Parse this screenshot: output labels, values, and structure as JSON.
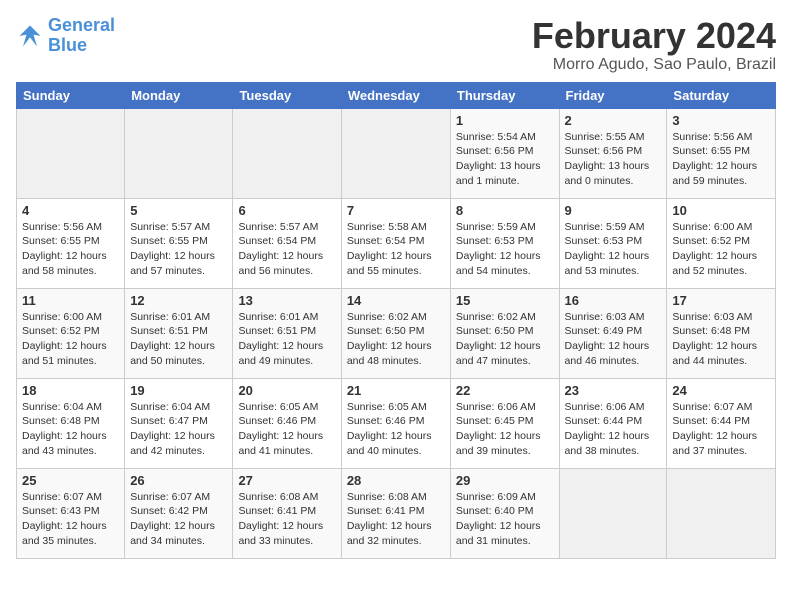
{
  "header": {
    "logo_line1": "General",
    "logo_line2": "Blue",
    "month": "February 2024",
    "location": "Morro Agudo, Sao Paulo, Brazil"
  },
  "weekdays": [
    "Sunday",
    "Monday",
    "Tuesday",
    "Wednesday",
    "Thursday",
    "Friday",
    "Saturday"
  ],
  "weeks": [
    [
      {
        "day": "",
        "info": ""
      },
      {
        "day": "",
        "info": ""
      },
      {
        "day": "",
        "info": ""
      },
      {
        "day": "",
        "info": ""
      },
      {
        "day": "1",
        "info": "Sunrise: 5:54 AM\nSunset: 6:56 PM\nDaylight: 13 hours\nand 1 minute."
      },
      {
        "day": "2",
        "info": "Sunrise: 5:55 AM\nSunset: 6:56 PM\nDaylight: 13 hours\nand 0 minutes."
      },
      {
        "day": "3",
        "info": "Sunrise: 5:56 AM\nSunset: 6:55 PM\nDaylight: 12 hours\nand 59 minutes."
      }
    ],
    [
      {
        "day": "4",
        "info": "Sunrise: 5:56 AM\nSunset: 6:55 PM\nDaylight: 12 hours\nand 58 minutes."
      },
      {
        "day": "5",
        "info": "Sunrise: 5:57 AM\nSunset: 6:55 PM\nDaylight: 12 hours\nand 57 minutes."
      },
      {
        "day": "6",
        "info": "Sunrise: 5:57 AM\nSunset: 6:54 PM\nDaylight: 12 hours\nand 56 minutes."
      },
      {
        "day": "7",
        "info": "Sunrise: 5:58 AM\nSunset: 6:54 PM\nDaylight: 12 hours\nand 55 minutes."
      },
      {
        "day": "8",
        "info": "Sunrise: 5:59 AM\nSunset: 6:53 PM\nDaylight: 12 hours\nand 54 minutes."
      },
      {
        "day": "9",
        "info": "Sunrise: 5:59 AM\nSunset: 6:53 PM\nDaylight: 12 hours\nand 53 minutes."
      },
      {
        "day": "10",
        "info": "Sunrise: 6:00 AM\nSunset: 6:52 PM\nDaylight: 12 hours\nand 52 minutes."
      }
    ],
    [
      {
        "day": "11",
        "info": "Sunrise: 6:00 AM\nSunset: 6:52 PM\nDaylight: 12 hours\nand 51 minutes."
      },
      {
        "day": "12",
        "info": "Sunrise: 6:01 AM\nSunset: 6:51 PM\nDaylight: 12 hours\nand 50 minutes."
      },
      {
        "day": "13",
        "info": "Sunrise: 6:01 AM\nSunset: 6:51 PM\nDaylight: 12 hours\nand 49 minutes."
      },
      {
        "day": "14",
        "info": "Sunrise: 6:02 AM\nSunset: 6:50 PM\nDaylight: 12 hours\nand 48 minutes."
      },
      {
        "day": "15",
        "info": "Sunrise: 6:02 AM\nSunset: 6:50 PM\nDaylight: 12 hours\nand 47 minutes."
      },
      {
        "day": "16",
        "info": "Sunrise: 6:03 AM\nSunset: 6:49 PM\nDaylight: 12 hours\nand 46 minutes."
      },
      {
        "day": "17",
        "info": "Sunrise: 6:03 AM\nSunset: 6:48 PM\nDaylight: 12 hours\nand 44 minutes."
      }
    ],
    [
      {
        "day": "18",
        "info": "Sunrise: 6:04 AM\nSunset: 6:48 PM\nDaylight: 12 hours\nand 43 minutes."
      },
      {
        "day": "19",
        "info": "Sunrise: 6:04 AM\nSunset: 6:47 PM\nDaylight: 12 hours\nand 42 minutes."
      },
      {
        "day": "20",
        "info": "Sunrise: 6:05 AM\nSunset: 6:46 PM\nDaylight: 12 hours\nand 41 minutes."
      },
      {
        "day": "21",
        "info": "Sunrise: 6:05 AM\nSunset: 6:46 PM\nDaylight: 12 hours\nand 40 minutes."
      },
      {
        "day": "22",
        "info": "Sunrise: 6:06 AM\nSunset: 6:45 PM\nDaylight: 12 hours\nand 39 minutes."
      },
      {
        "day": "23",
        "info": "Sunrise: 6:06 AM\nSunset: 6:44 PM\nDaylight: 12 hours\nand 38 minutes."
      },
      {
        "day": "24",
        "info": "Sunrise: 6:07 AM\nSunset: 6:44 PM\nDaylight: 12 hours\nand 37 minutes."
      }
    ],
    [
      {
        "day": "25",
        "info": "Sunrise: 6:07 AM\nSunset: 6:43 PM\nDaylight: 12 hours\nand 35 minutes."
      },
      {
        "day": "26",
        "info": "Sunrise: 6:07 AM\nSunset: 6:42 PM\nDaylight: 12 hours\nand 34 minutes."
      },
      {
        "day": "27",
        "info": "Sunrise: 6:08 AM\nSunset: 6:41 PM\nDaylight: 12 hours\nand 33 minutes."
      },
      {
        "day": "28",
        "info": "Sunrise: 6:08 AM\nSunset: 6:41 PM\nDaylight: 12 hours\nand 32 minutes."
      },
      {
        "day": "29",
        "info": "Sunrise: 6:09 AM\nSunset: 6:40 PM\nDaylight: 12 hours\nand 31 minutes."
      },
      {
        "day": "",
        "info": ""
      },
      {
        "day": "",
        "info": ""
      }
    ]
  ]
}
